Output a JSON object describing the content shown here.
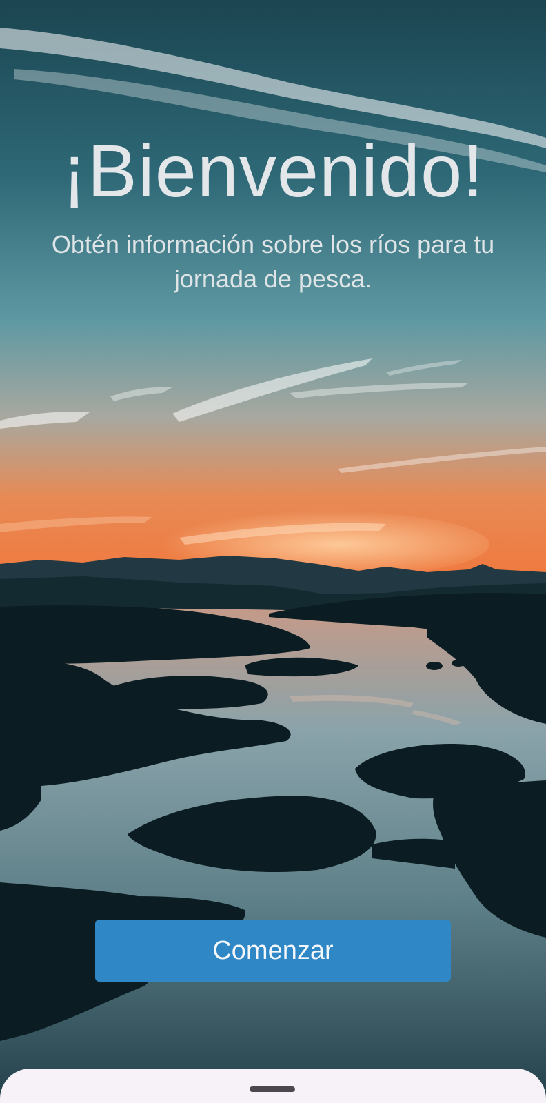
{
  "welcome": {
    "title": "¡Bienvenido!",
    "subtitle": "Obtén información sobre los ríos para tu jornada de pesca.",
    "start_button_label": "Comenzar"
  },
  "background": {
    "description_scene": "sunset-river-landscape",
    "colors": {
      "sky_top": "#1d4a56",
      "sky_mid": "#4c8c98",
      "horizon_glow": "#f0834a",
      "water": "#7c9aa4",
      "land": "#0b1d22"
    }
  },
  "theme": {
    "button_color": "#2f87c6",
    "sheet_color": "#f7f2f8"
  }
}
